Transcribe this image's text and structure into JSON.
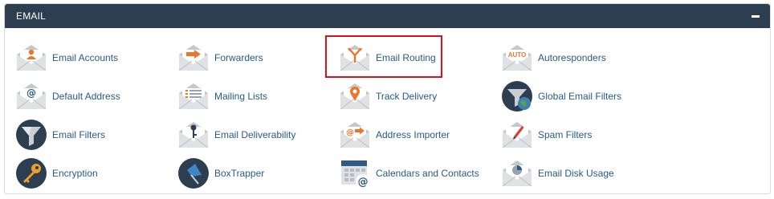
{
  "panel": {
    "title": "EMAIL",
    "collapse_icon": "minus-icon"
  },
  "items": [
    {
      "key": "email-accounts",
      "label": "Email Accounts",
      "icon": "envelope-person-icon"
    },
    {
      "key": "forwarders",
      "label": "Forwarders",
      "icon": "envelope-arrow-icon"
    },
    {
      "key": "email-routing",
      "label": "Email Routing",
      "icon": "envelope-fork-icon",
      "highlighted": true
    },
    {
      "key": "autoresponders",
      "label": "Autoresponders",
      "icon": "envelope-auto-icon",
      "badge": "AUTO"
    },
    {
      "key": "default-address",
      "label": "Default Address",
      "icon": "envelope-at-icon"
    },
    {
      "key": "mailing-lists",
      "label": "Mailing Lists",
      "icon": "envelope-list-icon"
    },
    {
      "key": "track-delivery",
      "label": "Track Delivery",
      "icon": "envelope-pin-icon"
    },
    {
      "key": "global-email-filters",
      "label": "Global Email Filters",
      "icon": "funnel-globe-icon"
    },
    {
      "key": "email-filters",
      "label": "Email Filters",
      "icon": "funnel-icon"
    },
    {
      "key": "email-deliverability",
      "label": "Email Deliverability",
      "icon": "envelope-key-icon"
    },
    {
      "key": "address-importer",
      "label": "Address Importer",
      "icon": "envelope-import-icon"
    },
    {
      "key": "spam-filters",
      "label": "Spam Filters",
      "icon": "envelope-pen-icon"
    },
    {
      "key": "encryption",
      "label": "Encryption",
      "icon": "key-icon"
    },
    {
      "key": "boxtrapper",
      "label": "BoxTrapper",
      "icon": "pin-icon"
    },
    {
      "key": "calendars-and-contacts",
      "label": "Calendars and Contacts",
      "icon": "calendar-at-icon"
    },
    {
      "key": "email-disk-usage",
      "label": "Email Disk Usage",
      "icon": "envelope-pie-icon"
    }
  ],
  "colors": {
    "header_bg": "#2d3e50",
    "link": "#295a84",
    "accent_orange": "#e9762c",
    "highlight_border": "#d9131d",
    "dark_circle": "#2d3e50"
  }
}
